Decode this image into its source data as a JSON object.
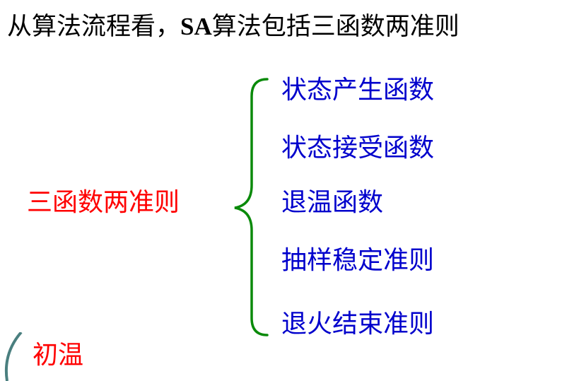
{
  "title": {
    "prefix": "从算法流程看，",
    "latin": "SA",
    "suffix": "算法包括三函数两准则"
  },
  "left_label": "三函数两准则",
  "items": [
    "状态产生函数",
    "状态接受函数",
    "退温函数",
    "抽样稳定准则",
    "退火结束准则"
  ],
  "bottom_label": "初温",
  "colors": {
    "title": "#000000",
    "left_label": "#ff0000",
    "items": "#0000cc",
    "bottom_label": "#ff0000",
    "brace": "#0a8a0a",
    "corner_arc": "#4a7f7f"
  }
}
